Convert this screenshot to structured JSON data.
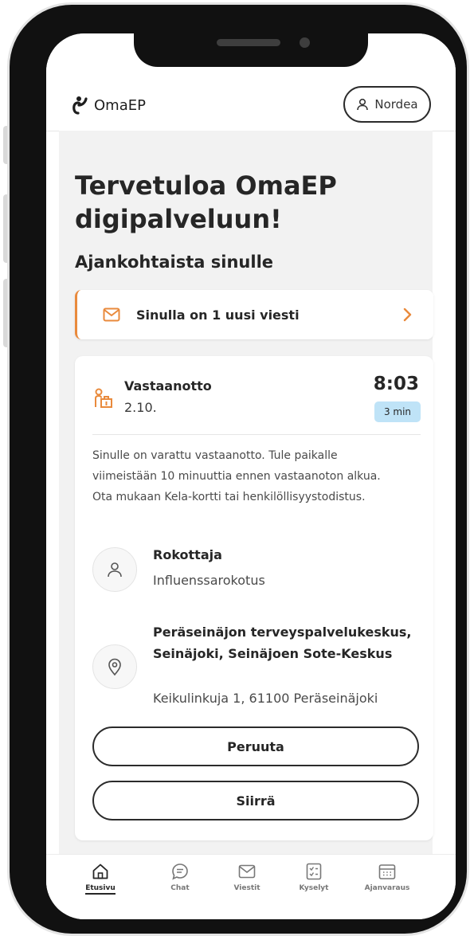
{
  "header": {
    "logo_text": "OmaEP",
    "user_button_label": "Nordea"
  },
  "main": {
    "welcome_title": "Tervetuloa OmaEP digipalveluun!",
    "section_title": "Ajankohtaista sinulle",
    "message_banner": {
      "text": "Sinulla on 1 uusi viesti",
      "accent_color": "#e98a3c"
    },
    "appointment": {
      "type": "Vastaanotto",
      "date": "2.10.",
      "time": "8:03",
      "duration": "3 min",
      "description": "Sinulle on varattu vastaanotto. Tule paikalle viimeistään 10 minuuttia ennen vastaanoton alkua. Ota mukaan Kela-kortti tai henkilöllisyystodistus.",
      "professional_title": "Rokottaja",
      "professional_service": "Influenssarokotus",
      "location_name": "Peräseinäjon terveyspalvelukeskus, Seinäjoki, Seinäjoen Sote-Keskus",
      "location_address": "Keikulinkuja 1, 61100 Peräseinäjoki",
      "cancel_label": "Peruuta",
      "move_label": "Siirrä"
    }
  },
  "bottom_nav": [
    {
      "label": "Etusivu",
      "icon": "home-icon",
      "active": true
    },
    {
      "label": "Chat",
      "icon": "chat-icon",
      "active": false
    },
    {
      "label": "Viestit",
      "icon": "mail-icon",
      "active": false
    },
    {
      "label": "Kyselyt",
      "icon": "survey-icon",
      "active": false
    },
    {
      "label": "Ajanvaraus",
      "icon": "calendar-icon",
      "active": false
    }
  ]
}
